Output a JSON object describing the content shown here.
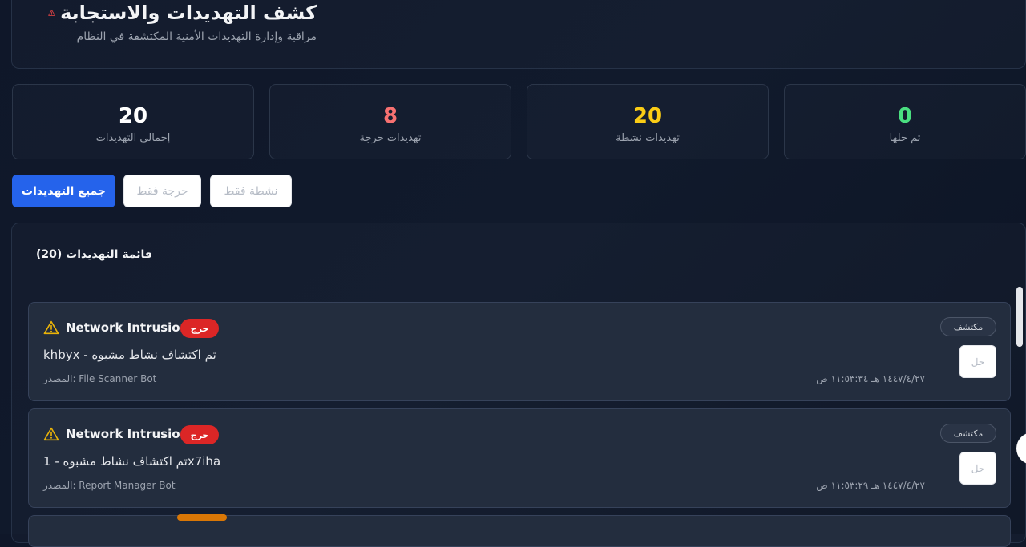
{
  "header": {
    "title": "كشف التهديدات والاستجابة",
    "subtitle": "مراقبة وإدارة التهديدات الأمنية المكتشفة في النظام",
    "icon": "alert-triangle-icon",
    "icon_color": "#ef4444"
  },
  "stats": [
    {
      "value": "20",
      "label": "إجمالي التهديدات",
      "color": "#ffffff"
    },
    {
      "value": "8",
      "label": "تهديدات حرجة",
      "color": "#f87171"
    },
    {
      "value": "20",
      "label": "تهديدات نشطة",
      "color": "#facc15"
    },
    {
      "value": "0",
      "label": "تم حلها",
      "color": "#4ade80"
    }
  ],
  "filters": {
    "all": "جميع التهديدات",
    "critical": "حرجة فقط",
    "active": "نشطة فقط",
    "active_color": "#2563eb"
  },
  "list": {
    "title": "قائمة التهديدات (20)",
    "items": [
      {
        "type": "Network Intrusion",
        "severity": "حرج",
        "description": "khbyx - تم اكتشاف نشاط مشبوه",
        "source": "المصدر: File Scanner Bot",
        "time": "١٤٤٧/٤/٢٧ هـ ١١:٥٣:٣٤ ص",
        "status": "مكتشف",
        "action": "حل",
        "icon": "warning-triangle-icon"
      },
      {
        "type": "Network Intrusion",
        "severity": "حرج",
        "description": "تم اكتشاف نشاط مشبوه - 1x7iha",
        "source": "المصدر: Report Manager Bot",
        "time": "١٤٤٧/٤/٢٧ هـ ١١:٥٣:٢٩ ص",
        "status": "مكتشف",
        "action": "حل",
        "icon": "warning-triangle-icon"
      }
    ]
  }
}
